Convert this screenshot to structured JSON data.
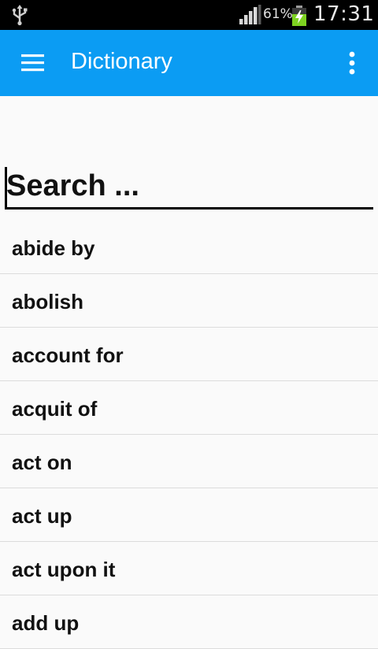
{
  "status_bar": {
    "battery_percent": "61%",
    "time": "17:31",
    "icons": [
      "usb-icon",
      "signal-icon",
      "battery-charging-icon"
    ]
  },
  "app_bar": {
    "title": "Dictionary",
    "background_color": "#0b9cf3",
    "icons": [
      "menu-icon",
      "overflow-menu-icon"
    ]
  },
  "search": {
    "placeholder": "Search ...",
    "value": ""
  },
  "words": [
    "abide by",
    "abolish",
    "account for",
    "acquit of",
    "act on",
    "act up",
    "act upon it",
    "add up"
  ]
}
